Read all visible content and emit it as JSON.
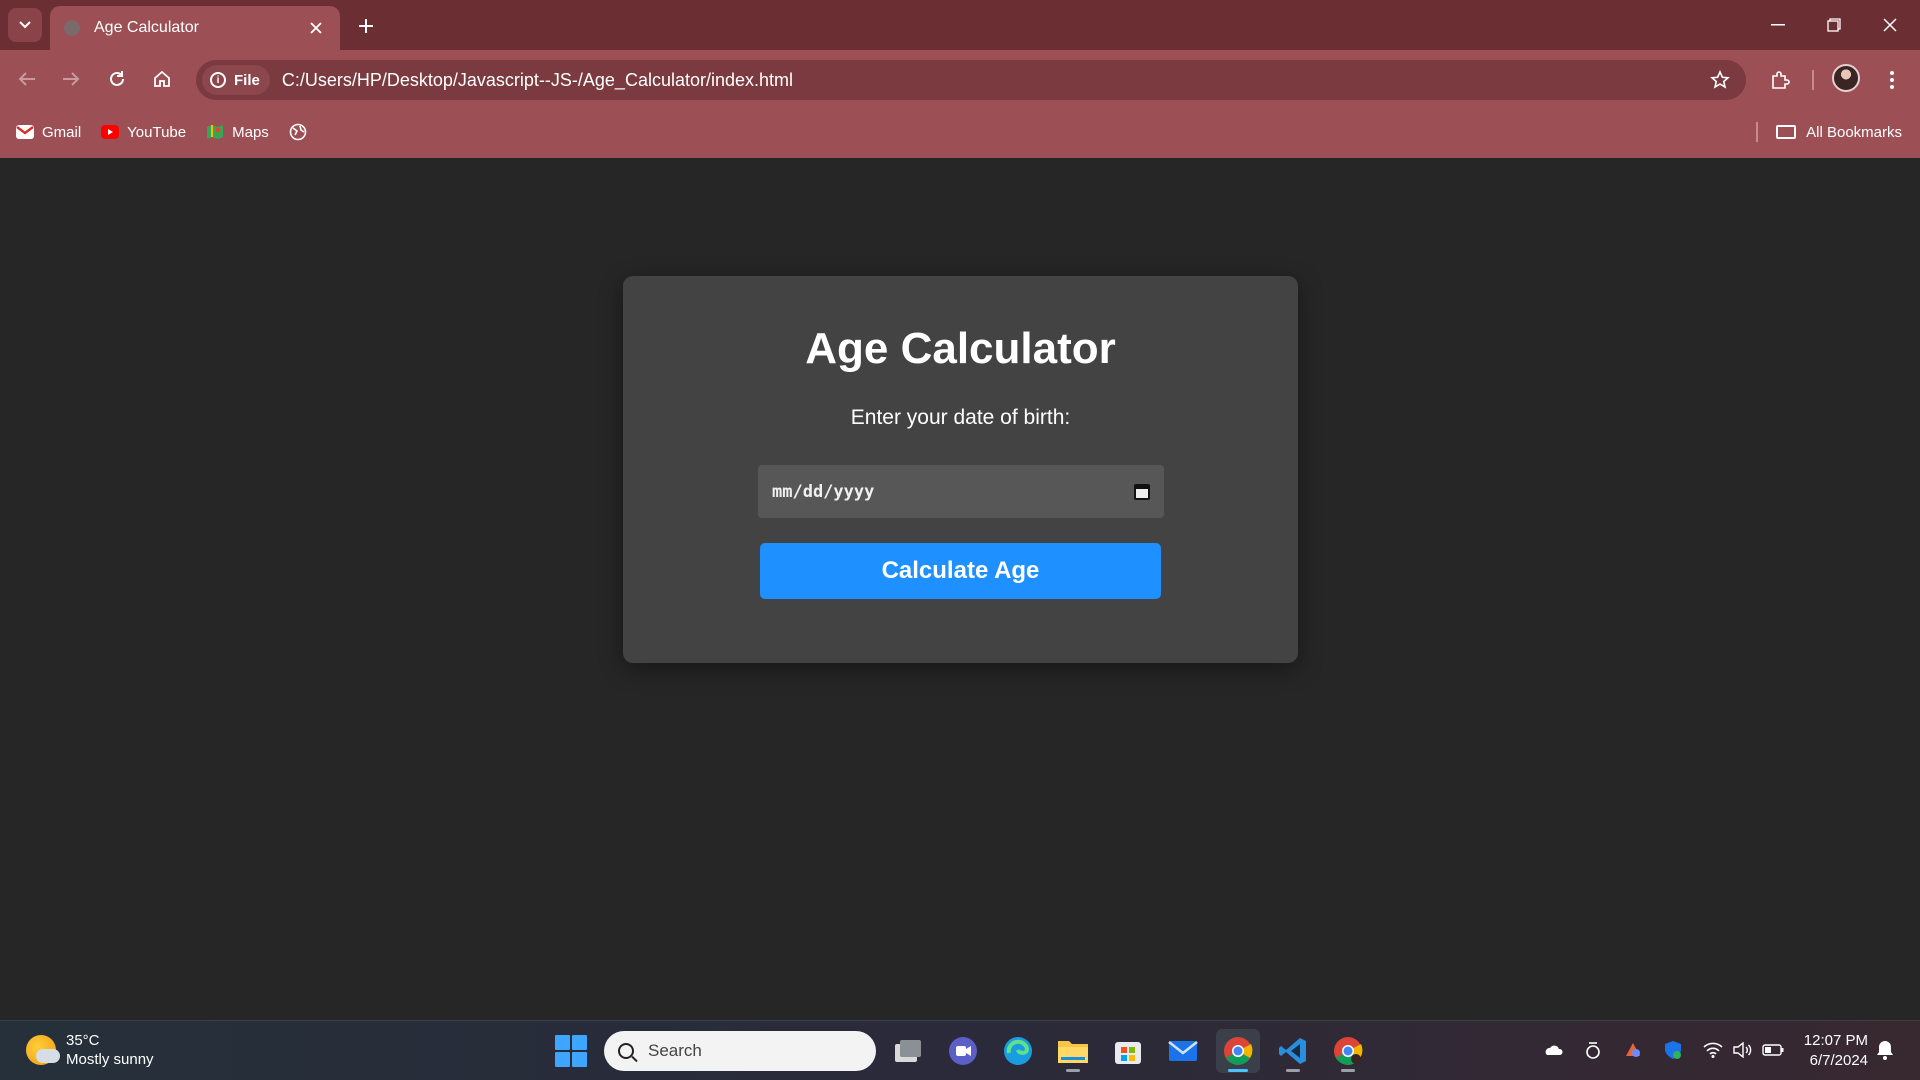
{
  "browser": {
    "tab": {
      "title": "Age Calculator"
    },
    "address": {
      "chip_label": "File",
      "url": "C:/Users/HP/Desktop/Javascript--JS-/Age_Calculator/index.html"
    },
    "bookmarks": [
      {
        "label": "Gmail",
        "icon": "gmail-icon",
        "color": "#d93025"
      },
      {
        "label": "YouTube",
        "icon": "youtube-icon",
        "color": "#ff0000"
      },
      {
        "label": "Maps",
        "icon": "maps-icon",
        "color": "#34a853"
      }
    ],
    "all_bookmarks_label": "All Bookmarks"
  },
  "page": {
    "heading": "Age Calculator",
    "prompt": "Enter your date of birth:",
    "date_input": {
      "placeholder": "mm/dd/yyyy"
    },
    "calculate_button": "Calculate Age",
    "accent_color": "#1e90ff"
  },
  "taskbar": {
    "weather": {
      "temperature": "35°C",
      "condition": "Mostly sunny"
    },
    "search_placeholder": "Search",
    "clock": {
      "time": "12:07 PM",
      "date": "6/7/2024"
    }
  }
}
